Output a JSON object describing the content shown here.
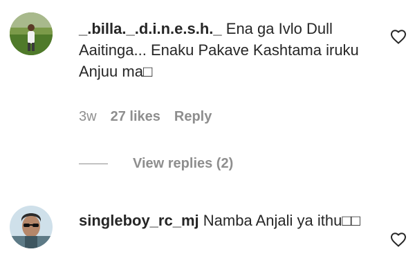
{
  "comments": [
    {
      "username": "_.billa._.d.i.n.e.s.h._",
      "text": "Ena ga Ivlo Dull Aaitinga... Enaku Pakave Kashtama iruku Anjuu ma□",
      "time": "3w",
      "likes": "27 likes",
      "reply_label": "Reply",
      "view_replies": "View replies (2)",
      "avatar_icon": "user-avatar-outdoor"
    },
    {
      "username": "singleboy_rc_mj",
      "text": "Namba Anjali ya ithu□□",
      "avatar_icon": "user-avatar-sunglasses"
    }
  ],
  "icons": {
    "like": "heart-outline-icon"
  },
  "colors": {
    "text": "#262626",
    "secondary": "#8e8e8e",
    "background": "#ffffff"
  }
}
